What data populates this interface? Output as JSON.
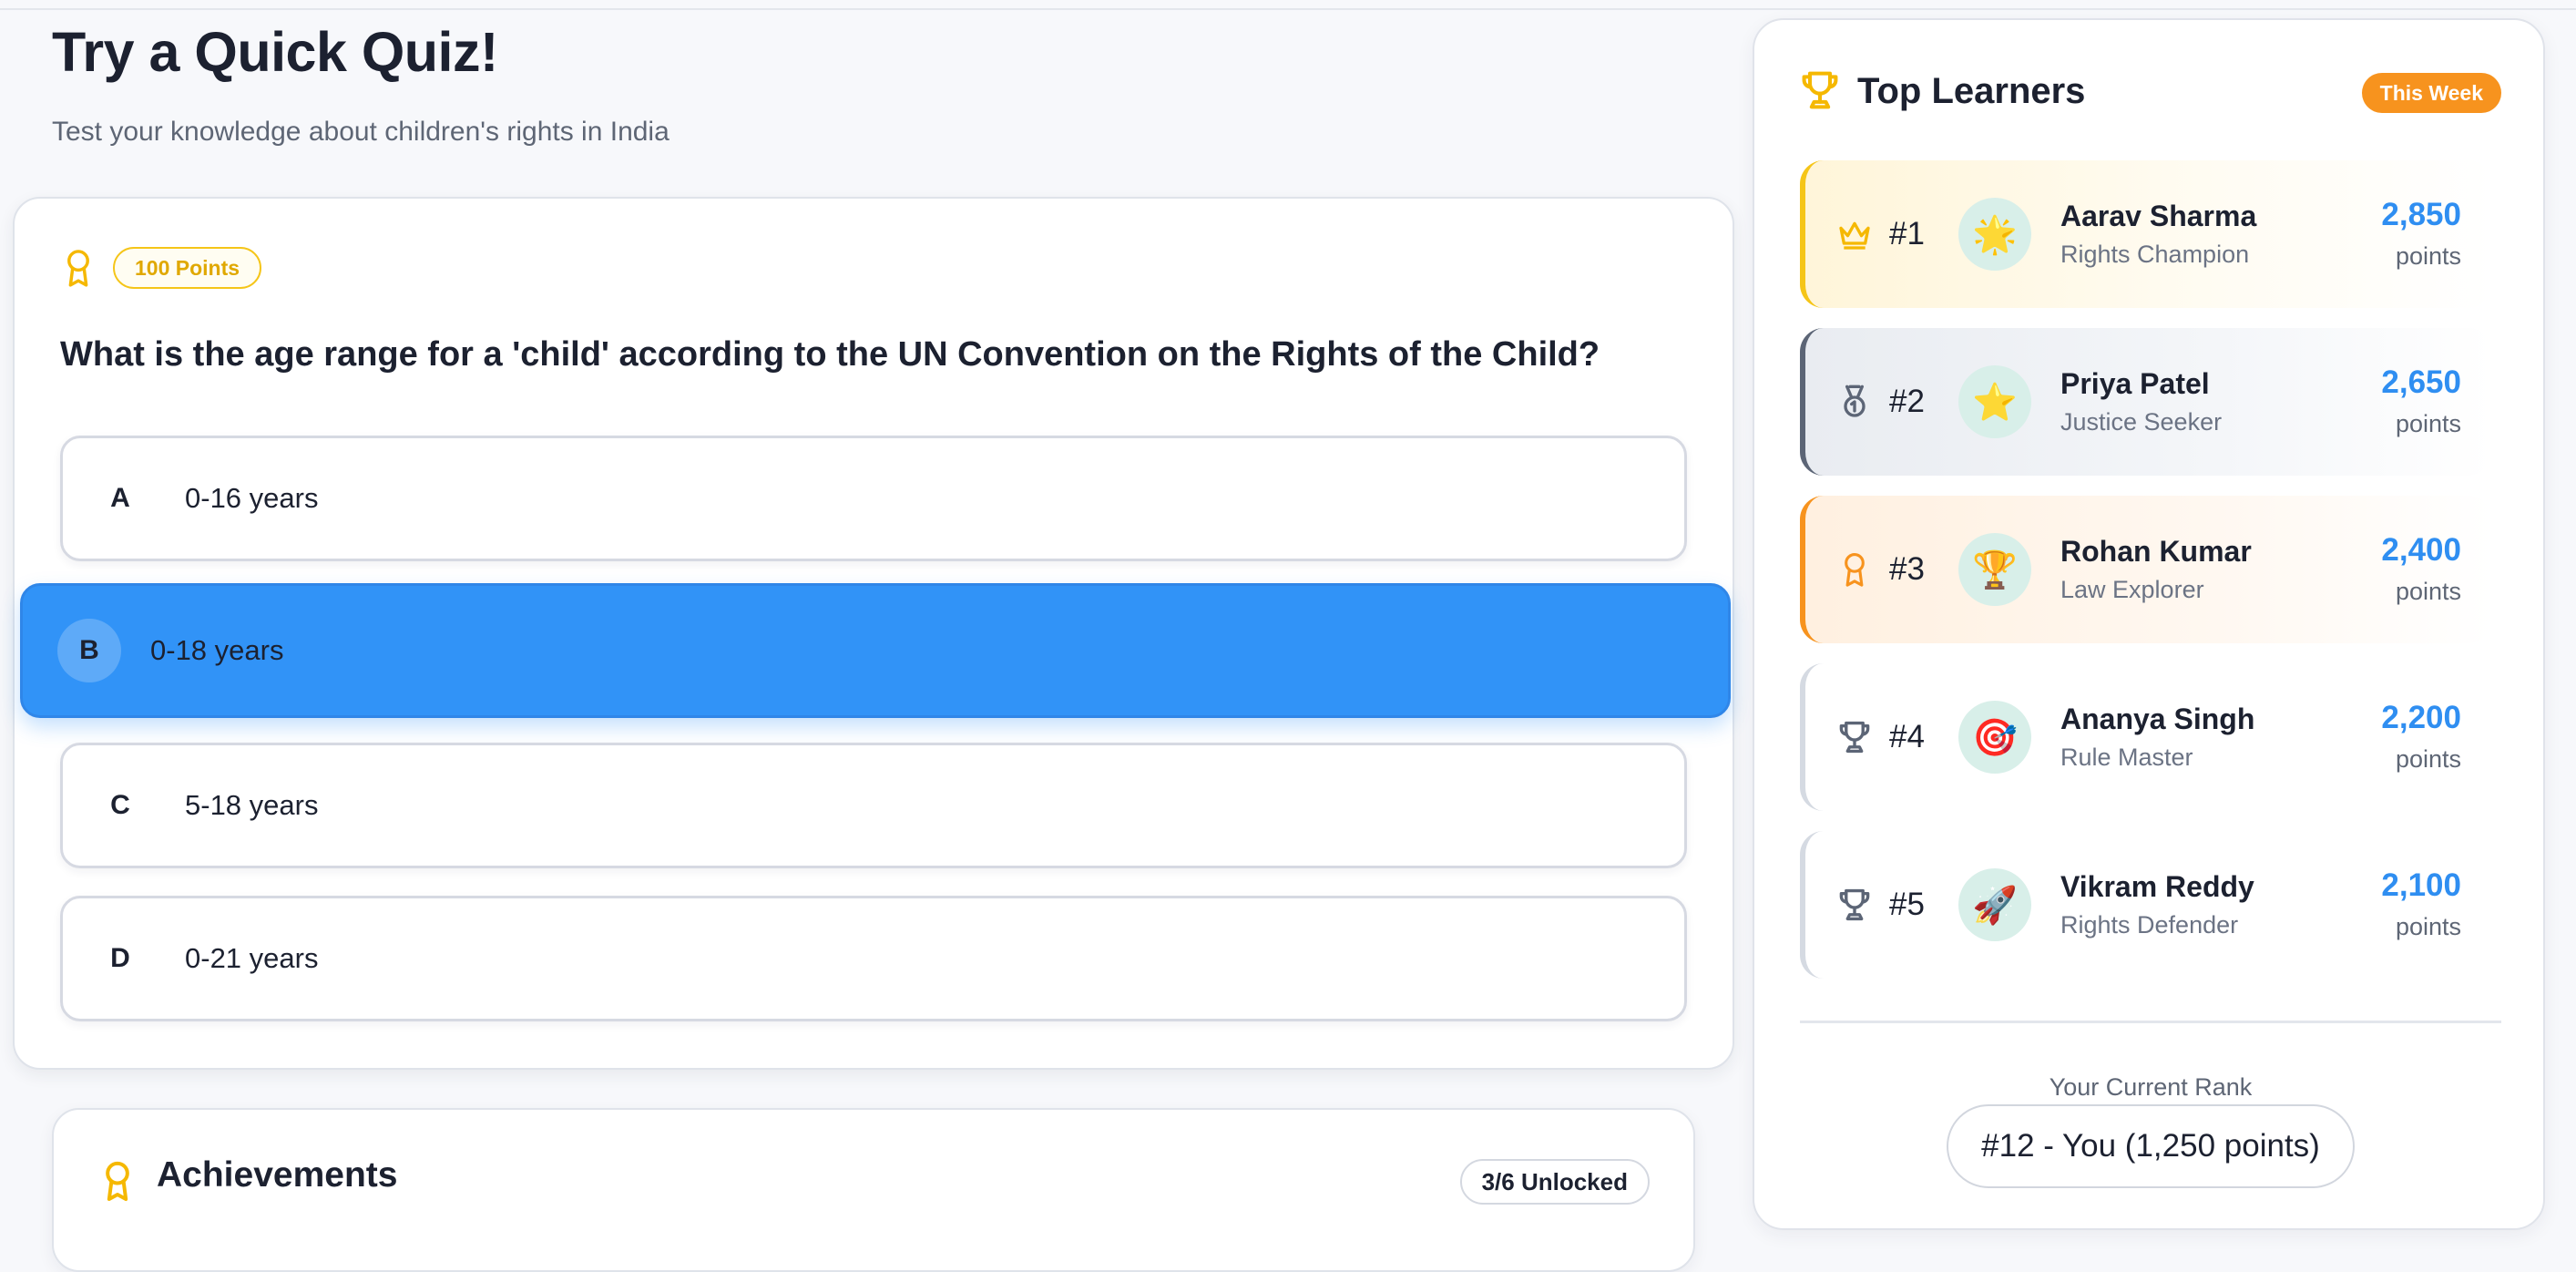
{
  "header": {
    "title": "Try a Quick Quiz!",
    "subtitle": "Test your knowledge about children's rights in India"
  },
  "quiz": {
    "points_label": "100 Points",
    "question": "What is the age range for a 'child' according to the UN Convention on the Rights of the Child?",
    "selected_option": "B",
    "options": [
      {
        "letter": "A",
        "text": "0-16 years"
      },
      {
        "letter": "B",
        "text": "0-18 years"
      },
      {
        "letter": "C",
        "text": "5-18 years"
      },
      {
        "letter": "D",
        "text": "0-21 years"
      }
    ]
  },
  "achievements": {
    "title": "Achievements",
    "badge": "3/6 Unlocked"
  },
  "leaderboard": {
    "title": "Top Learners",
    "period_badge": "This Week",
    "learners": [
      {
        "rank": "#1",
        "name": "Aarav Sharma",
        "title": "Rights Champion",
        "points": "2,850",
        "points_label": "points",
        "avatar": "🌟",
        "rank_icon": "crown-icon"
      },
      {
        "rank": "#2",
        "name": "Priya Patel",
        "title": "Justice Seeker",
        "points": "2,650",
        "points_label": "points",
        "avatar": "⭐",
        "rank_icon": "medal-icon"
      },
      {
        "rank": "#3",
        "name": "Rohan Kumar",
        "title": "Law Explorer",
        "points": "2,400",
        "points_label": "points",
        "avatar": "🏆",
        "rank_icon": "award-icon"
      },
      {
        "rank": "#4",
        "name": "Ananya Singh",
        "title": "Rule Master",
        "points": "2,200",
        "points_label": "points",
        "avatar": "🎯",
        "rank_icon": "trophy-icon"
      },
      {
        "rank": "#5",
        "name": "Vikram Reddy",
        "title": "Rights Defender",
        "points": "2,100",
        "points_label": "points",
        "avatar": "🚀",
        "rank_icon": "trophy-icon"
      }
    ],
    "current_rank_caption": "Your Current Rank",
    "current_rank": "#12 - You (1,250 points)"
  },
  "colors": {
    "accent_blue": "#3193f7",
    "points_blue": "#2f8ef1",
    "gold": "#f5c518",
    "orange": "#f7931e",
    "silver": "#5c6576"
  }
}
